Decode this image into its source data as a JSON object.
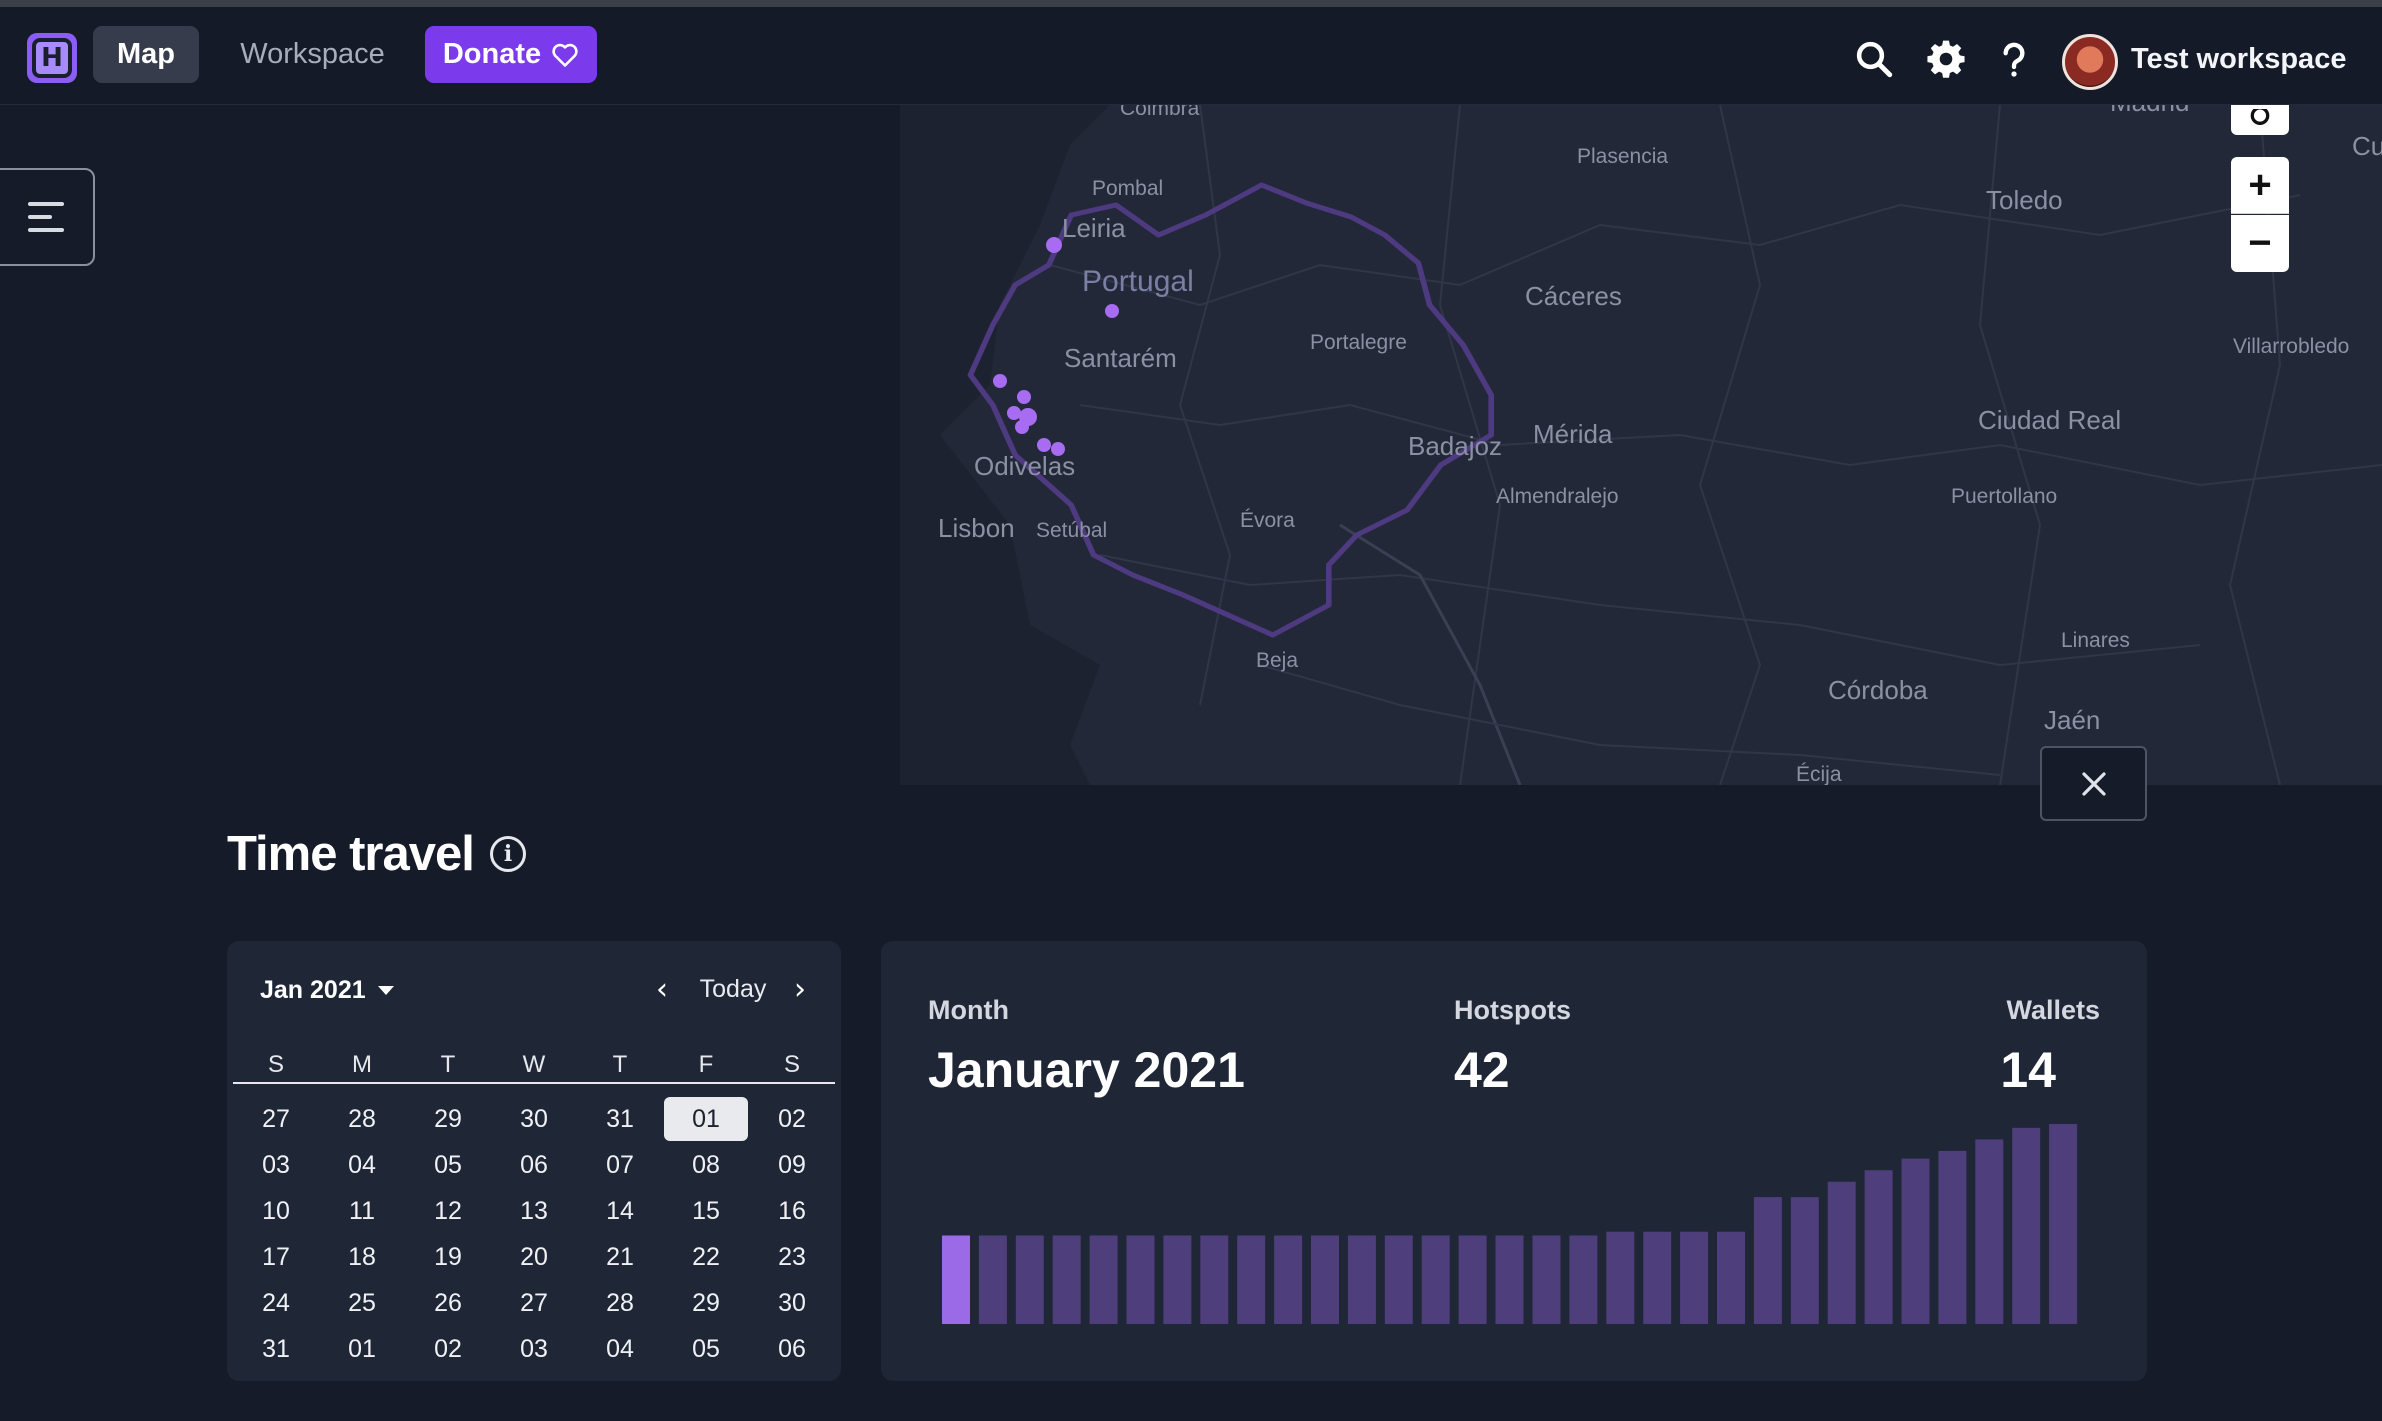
{
  "nav": {
    "logo_letter": "H",
    "map_label": "Map",
    "workspace_label": "Workspace",
    "donate_label": "Donate",
    "user_name": "Test workspace"
  },
  "map": {
    "cities": [
      {
        "name": "Coimbra"
      },
      {
        "name": "Plasencia"
      },
      {
        "name": "Pombal"
      },
      {
        "name": "Toledo"
      },
      {
        "name": "Leiria"
      },
      {
        "name": "Portugal"
      },
      {
        "name": "Cáceres"
      },
      {
        "name": "Santarém"
      },
      {
        "name": "Portalegre"
      },
      {
        "name": "Villarrobledo"
      },
      {
        "name": "Ciudad Real"
      },
      {
        "name": "Mérida"
      },
      {
        "name": "Badajoz"
      },
      {
        "name": "Odivelas"
      },
      {
        "name": "Almendralejo"
      },
      {
        "name": "Puertollano"
      },
      {
        "name": "Lisbon"
      },
      {
        "name": "Setúbal"
      },
      {
        "name": "Évora"
      },
      {
        "name": "Beja"
      },
      {
        "name": "Linares"
      },
      {
        "name": "Córdoba"
      },
      {
        "name": "Jaén"
      },
      {
        "name": "Écija"
      },
      {
        "name": "Madrid"
      },
      {
        "name": "Cu"
      }
    ],
    "zoom_in": "+",
    "zoom_out": "−",
    "accent": "#a76cf2"
  },
  "time_travel": {
    "title": "Time travel",
    "info_icon": "i"
  },
  "calendar": {
    "month_label": "Jan 2021",
    "today_label": "Today",
    "weekdays": [
      "S",
      "M",
      "T",
      "W",
      "T",
      "F",
      "S"
    ],
    "days": [
      "27",
      "28",
      "29",
      "30",
      "31",
      "01",
      "02",
      "03",
      "04",
      "05",
      "06",
      "07",
      "08",
      "09",
      "10",
      "11",
      "12",
      "13",
      "14",
      "15",
      "16",
      "17",
      "18",
      "19",
      "20",
      "21",
      "22",
      "23",
      "24",
      "25",
      "26",
      "27",
      "28",
      "29",
      "30",
      "31",
      "01",
      "02",
      "03",
      "04",
      "05",
      "06"
    ],
    "selected_index": 5
  },
  "stats": {
    "month_label": "Month",
    "month_value": "January 2021",
    "hotspots_label": "Hotspots",
    "hotspots_value": "42",
    "wallets_label": "Wallets",
    "wallets_value": "14"
  },
  "chart_data": {
    "type": "bar",
    "values": [
      23,
      23,
      23,
      23,
      23,
      23,
      23,
      23,
      23,
      23,
      23,
      23,
      23,
      23,
      23,
      23,
      23,
      23,
      24,
      24,
      24,
      24,
      33,
      33,
      37,
      40,
      43,
      45,
      48,
      51,
      52
    ],
    "highlight_index": 0,
    "colors": {
      "highlight": "#9b6ae6",
      "normal": "#4e3e7b"
    }
  }
}
